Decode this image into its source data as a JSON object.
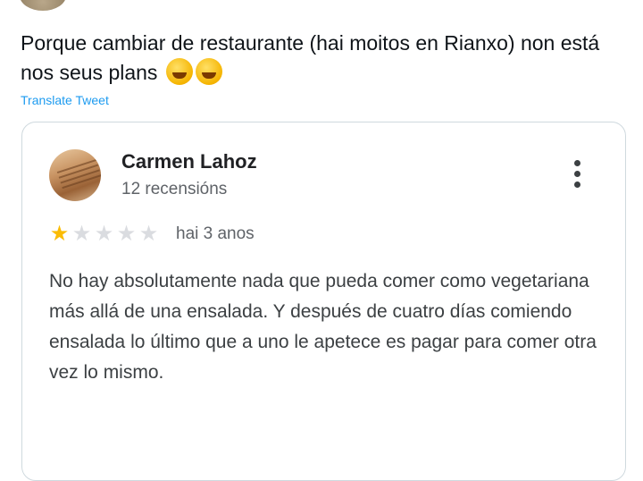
{
  "tweet": {
    "text": "Porque cambiar de restaurante (hai moitos en Rianxo) non está nos seus plans",
    "emoji_count": 2,
    "emoji_icon": "rolling-on-floor-laughing",
    "translate_label": "Translate Tweet"
  },
  "review": {
    "author": "Carmen Lahoz",
    "review_count": "12 recensións",
    "rating": 1,
    "max_rating": 5,
    "age": "hai 3 anos",
    "body": "No hay absolutamente nada que pueda comer como vegetariana más allá de una ensalada. Y después de cuatro días comiendo ensalada lo último que a uno le apetece es pagar para comer otra vez lo mismo."
  },
  "colors": {
    "link": "#1d9bf0",
    "star_filled": "#fbbc04",
    "star_empty": "#dadce0"
  }
}
